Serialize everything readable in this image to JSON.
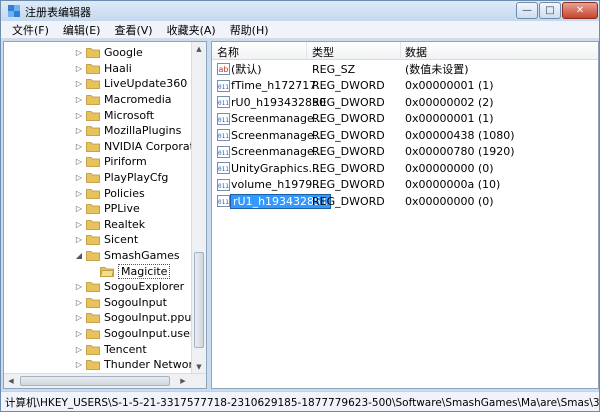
{
  "window": {
    "title": "注册表编辑器",
    "minimize_glyph": "—",
    "maximize_glyph": "□",
    "close_glyph": "✕"
  },
  "menu": [
    "文件(F)",
    "编辑(E)",
    "查看(V)",
    "收藏夹(A)",
    "帮助(H)"
  ],
  "tree": {
    "items": [
      {
        "label": "Google",
        "arrow": "▷",
        "selected": false
      },
      {
        "label": "Haali",
        "arrow": "▷",
        "selected": false
      },
      {
        "label": "LiveUpdate360",
        "arrow": "▷",
        "selected": false
      },
      {
        "label": "Macromedia",
        "arrow": "▷",
        "selected": false
      },
      {
        "label": "Microsoft",
        "arrow": "▷",
        "selected": false
      },
      {
        "label": "MozillaPlugins",
        "arrow": "▷",
        "selected": false
      },
      {
        "label": "NVIDIA Corporation",
        "arrow": "▷",
        "selected": false
      },
      {
        "label": "Piriform",
        "arrow": "▷",
        "selected": false
      },
      {
        "label": "PlayPlayCfg",
        "arrow": "▷",
        "selected": false
      },
      {
        "label": "Policies",
        "arrow": "▷",
        "selected": false
      },
      {
        "label": "PPLive",
        "arrow": "▷",
        "selected": false
      },
      {
        "label": "Realtek",
        "arrow": "▷",
        "selected": false
      },
      {
        "label": "Sicent",
        "arrow": "▷",
        "selected": false
      },
      {
        "label": "SmashGames",
        "arrow": "◢",
        "selected": false
      },
      {
        "label": "Magicite",
        "arrow": "",
        "selected": true
      },
      {
        "label": "SogouExplorer",
        "arrow": "▷",
        "selected": false
      },
      {
        "label": "SogouInput",
        "arrow": "▷",
        "selected": false
      },
      {
        "label": "SogouInput.ppup",
        "arrow": "▷",
        "selected": false
      },
      {
        "label": "SogouInput.user",
        "arrow": "▷",
        "selected": false
      },
      {
        "label": "Tencent",
        "arrow": "▷",
        "selected": false
      },
      {
        "label": "Thunder Network",
        "arrow": "▷",
        "selected": false
      }
    ]
  },
  "values": {
    "headers": {
      "name": "名称",
      "type": "类型",
      "data": "数据"
    },
    "rows": [
      {
        "icon": "string-value-icon",
        "name": "(默认)",
        "type": "REG_SZ",
        "data": "(数值未设置)"
      },
      {
        "icon": "binary-value-icon",
        "name": "fTime_h172717...",
        "type": "REG_DWORD",
        "data": "0x00000001 (1)"
      },
      {
        "icon": "binary-value-icon",
        "name": "rU0_h193432850",
        "type": "REG_DWORD",
        "data": "0x00000002 (2)"
      },
      {
        "icon": "binary-value-icon",
        "name": "Screenmanage...",
        "type": "REG_DWORD",
        "data": "0x00000001 (1)"
      },
      {
        "icon": "binary-value-icon",
        "name": "Screenmanage...",
        "type": "REG_DWORD",
        "data": "0x00000438 (1080)"
      },
      {
        "icon": "binary-value-icon",
        "name": "Screenmanage...",
        "type": "REG_DWORD",
        "data": "0x00000780 (1920)"
      },
      {
        "icon": "binary-value-icon",
        "name": "UnityGraphics...",
        "type": "REG_DWORD",
        "data": "0x00000000 (0)"
      },
      {
        "icon": "binary-value-icon",
        "name": "volume_h1979...",
        "type": "REG_DWORD",
        "data": "0x0000000a (10)"
      },
      {
        "icon": "binary-value-icon",
        "name": "rU1_h193432851",
        "type": "REG_DWORD",
        "data": "0x00000000 (0)",
        "editing": true
      }
    ]
  },
  "statusbar": {
    "path": "计算机\\HKEY_USERS\\S-1-5-21-3317577718-2310629185-1877779623-500\\Software\\SmashGames\\Ma\\are\\Smas\\3-500\\Software\\Sma"
  },
  "colors": {
    "frame": "#c9dcf0",
    "selection": "#3399ff",
    "folder": "#e8c25a"
  }
}
